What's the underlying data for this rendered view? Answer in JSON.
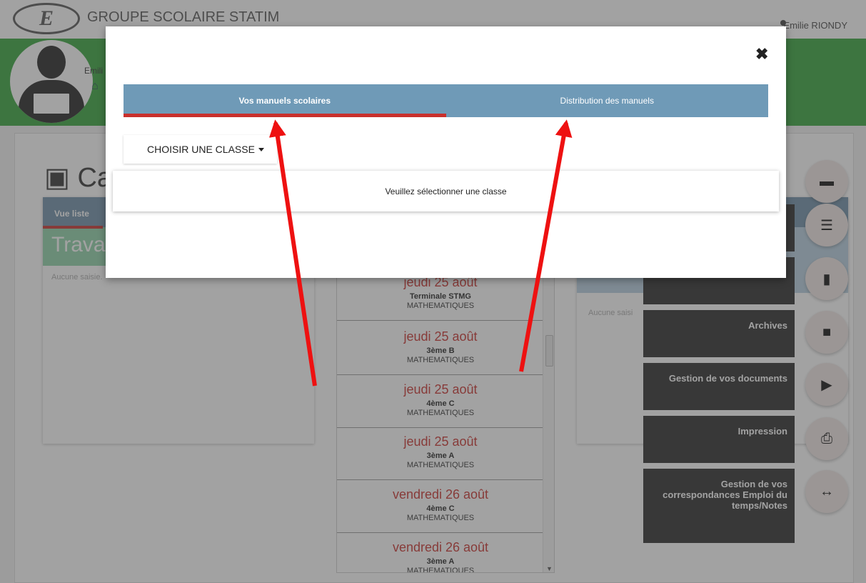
{
  "header": {
    "school_name": "GROUPE SCOLAIRE STATIM",
    "user_name": "Emilie RIONDY",
    "logo_letter": "E",
    "profile_name_partial": "Emili"
  },
  "background": {
    "page_title_partial": "Cah",
    "left_panel": {
      "tab_label": "Vue liste",
      "section_partial": "Trava",
      "empty_text": "Aucune saisie."
    },
    "right_panel": {
      "empty_text": "Aucune saisi"
    },
    "schedule": [
      {
        "date": "jeudi 25 août",
        "class": "Terminale STMG",
        "subject": "MATHEMATIQUES"
      },
      {
        "date": "jeudi 25 août",
        "class": "3ème B",
        "subject": "MATHEMATIQUES"
      },
      {
        "date": "jeudi 25 août",
        "class": "4ème C",
        "subject": "MATHEMATIQUES"
      },
      {
        "date": "jeudi 25 août",
        "class": "3ème A",
        "subject": "MATHEMATIQUES"
      },
      {
        "date": "vendredi 26 août",
        "class": "4ème C",
        "subject": "MATHEMATIQUES"
      },
      {
        "date": "vendredi 26 août",
        "class": "3ème A",
        "subject": "MATHEMATIQUES"
      }
    ],
    "tiles": [
      {
        "label": "Archives"
      },
      {
        "label": "Gestion de vos documents"
      },
      {
        "label": "Impression"
      },
      {
        "label": "Gestion de vos correspondances Emploi du temps/Notes"
      }
    ],
    "fab_icons": [
      "minus-icon",
      "database-icon",
      "book-icon",
      "archive-icon",
      "folder-open-icon",
      "print-icon",
      "arrows-h-icon"
    ]
  },
  "modal": {
    "close_label": "✖",
    "tabs": [
      {
        "label": "Vos manuels scolaires",
        "active": true
      },
      {
        "label": "Distribution des manuels",
        "active": false
      }
    ],
    "choose_class_label": "CHOISIR UNE CLASSE",
    "message": "Veuillez sélectionner une classe"
  },
  "colors": {
    "tab_bar": "#6f9ab7",
    "active_underline": "#c9302c",
    "annotation_arrow": "#ee1111",
    "header_green": "#35a53a"
  }
}
